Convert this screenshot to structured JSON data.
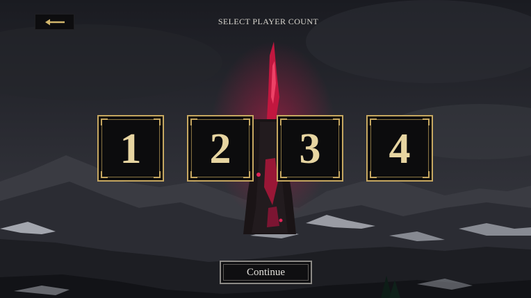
{
  "header": {
    "back_icon": "left-arrow-icon",
    "title": "SELECT PLAYER COUNT"
  },
  "player_count": {
    "options": [
      "1",
      "2",
      "3",
      "4"
    ]
  },
  "footer": {
    "continue_label": "Continue"
  },
  "colors": {
    "accent_gold": "#c6a760",
    "numeral": "#e7d5a1",
    "tower_glow": "#d0184a",
    "button_bg": "#0c0c0d"
  }
}
